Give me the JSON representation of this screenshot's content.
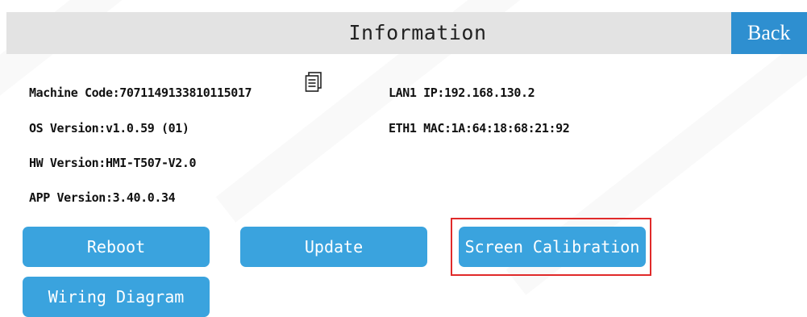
{
  "header": {
    "title": "Information",
    "back_label": "Back"
  },
  "info": {
    "machine_code": "Machine Code:7071149133810115017",
    "os_version": "OS Version:v1.0.59 (01)",
    "hw_version": "HW Version:HMI-T507-V2.0",
    "app_version": "APP Version:3.40.0.34",
    "lan_ip": "LAN1 IP:192.168.130.2",
    "eth_mac": "ETH1 MAC:1A:64:18:68:21:92"
  },
  "buttons": {
    "reboot": "Reboot",
    "update": "Update",
    "screen_calibration": "Screen Calibration",
    "wiring_diagram": "Wiring Diagram"
  },
  "icons": {
    "copy": "copy-icon"
  },
  "colors": {
    "header_bg": "#e3e3e3",
    "back_bg": "#2e8fd0",
    "button_bg": "#3aa3de",
    "highlight_border": "#e02a2a"
  }
}
